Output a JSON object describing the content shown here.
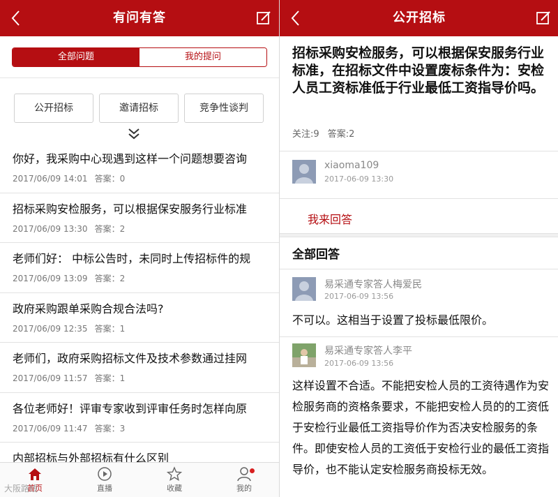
{
  "left": {
    "title": "有问有答",
    "tabs": [
      {
        "label": "全部问题",
        "active": true
      },
      {
        "label": "我的提问",
        "active": false
      }
    ],
    "categories": [
      "公开招标",
      "邀请招标",
      "竞争性谈判"
    ],
    "questions": [
      {
        "title": "你好，我采购中心现遇到这样一个问题想要咨询",
        "date": "2017/06/09 14:01",
        "answers_label": "答案：0"
      },
      {
        "title": "招标采购安检服务，可以根据保安服务行业标准",
        "date": "2017/06/09 13:30",
        "answers_label": "答案：2"
      },
      {
        "title": "老师们好：  中标公告时，未同时上传招标件的规",
        "date": "2017/06/09 13:09",
        "answers_label": "答案：2"
      },
      {
        "title": "政府采购跟单采购合规合法吗?",
        "date": "2017/06/09 12:35",
        "answers_label": "答案：1"
      },
      {
        "title": "老师们，政府采购招标文件及技术参数通过挂网",
        "date": "2017/06/09 11:57",
        "answers_label": "答案：1"
      },
      {
        "title": "各位老师好！评审专家收到评审任务时怎样向原",
        "date": "2017/06/09 11:47",
        "answers_label": "答案：3"
      },
      {
        "title": "内部招标与外部招标有什么区别",
        "date": "",
        "answers_label": ""
      }
    ],
    "nav": [
      {
        "label": "首页",
        "icon": "home-icon",
        "active": true
      },
      {
        "label": "直播",
        "icon": "play-icon",
        "active": false
      },
      {
        "label": "收藏",
        "icon": "star-icon",
        "active": false
      },
      {
        "label": "我的",
        "icon": "user-icon",
        "active": false
      }
    ],
    "watermark": "大阪路线"
  },
  "right": {
    "title": "公开招标",
    "question_title": "招标采购安检服务，可以根据保安服务行业标准，在招标文件中设置废标条件为：安检人员工资标准低于行业最低工资指导价吗。",
    "follow_label": "关注:9",
    "answers_label": "答案:2",
    "asker": {
      "name": "xiaoma109",
      "time": "2017-06-09 13:30"
    },
    "answer_button": "我来回答",
    "all_answers_header": "全部回答",
    "answers": [
      {
        "name": "易采通专家答人梅爱民",
        "time": "2017-06-09 13:56",
        "text": "不可以。这相当于设置了投标最低限价。"
      },
      {
        "name": "易采通专家答人李平",
        "time": "2017-06-09 13:56",
        "text": "这样设置不合适。不能把安检人员的工资待遇作为安检服务商的资格条要求，不能把安检人员的的工资低于安检行业最低工资指导价作为否决安检服务的条件。即使安检人员的工资低于安检行业的最低工资指导价，也不能认定安检服务商投标无效。"
      }
    ]
  },
  "colors": {
    "brand": "#b50e12",
    "divider": "#e2e2e2",
    "meta_text": "#777777"
  }
}
